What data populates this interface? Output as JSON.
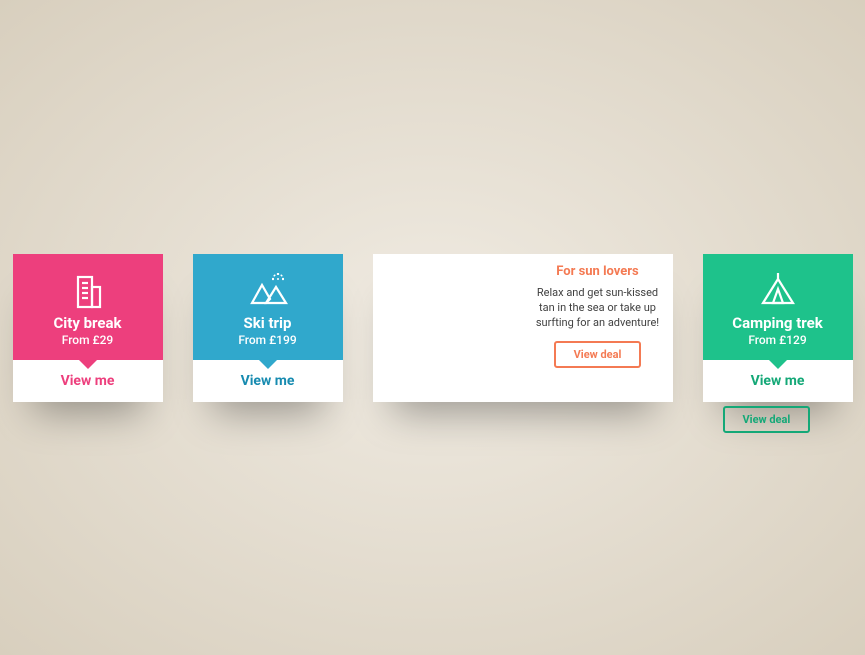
{
  "cards": {
    "city": {
      "title": "City break",
      "sub": "From £29",
      "cta": "View me"
    },
    "ski": {
      "title": "Ski trip",
      "sub": "From £199",
      "cta": "View me"
    },
    "beach": {
      "title": "For sun lovers",
      "desc": "Relax and get sun-kissed tan in the sea or take up surfting for an adventure!",
      "cta": "View deal"
    },
    "camp": {
      "title": "Camping trek",
      "sub": "From £129",
      "cta": "View me",
      "ghost_cta": "View deal"
    }
  }
}
